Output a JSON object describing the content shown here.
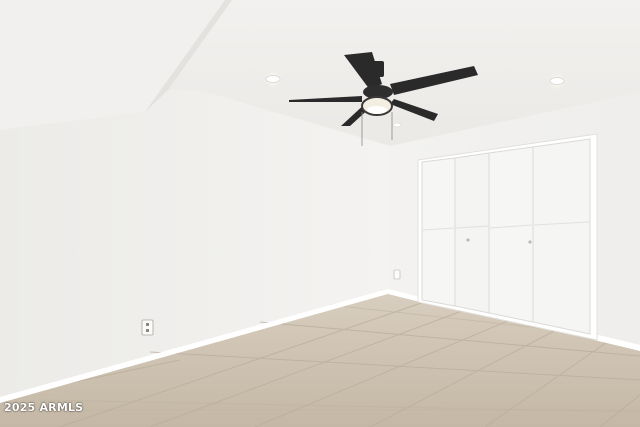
{
  "watermark": "2025 ARMLS",
  "colors": {
    "wall_light": "#f3f2f0",
    "wall_shadow": "#e6e4e1",
    "ceiling": "#efeeec",
    "floor_tile": "#cdc1b1",
    "baseboard": "#ffffff",
    "fan_blade": "#2b2a2a",
    "closet_door": "#f6f6f5"
  },
  "icons": [
    "ceiling-fan-icon",
    "recessed-light-icon",
    "wall-outlet-icon"
  ]
}
